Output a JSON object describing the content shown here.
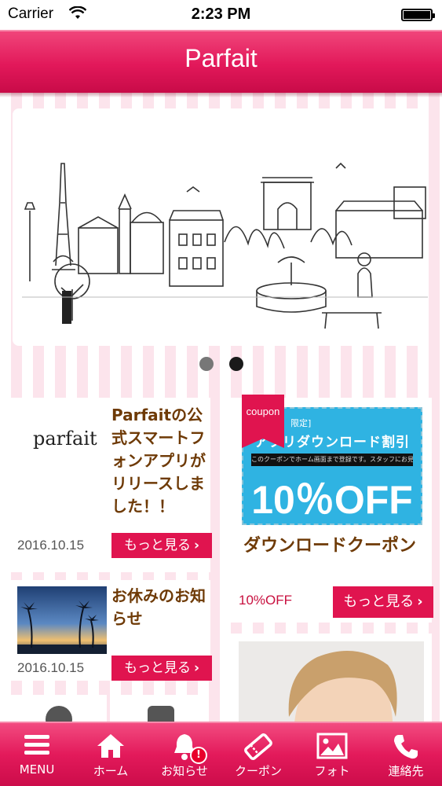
{
  "status_bar": {
    "carrier": "Carrier",
    "time": "2:23 PM"
  },
  "header": {
    "title": "Parfait"
  },
  "slider": {
    "page_count": 2,
    "active_index": 1
  },
  "news": [
    {
      "thumb_text": "parfait",
      "title": "Parfaitの公式スマートフォンアプリがリリースしました！！",
      "date": "2016.10.15",
      "more_label": "もっと見る"
    },
    {
      "title": "お休みのお知らせ",
      "date": "2016.10.15",
      "more_label": "もっと見る"
    }
  ],
  "coupon": {
    "ribbon": "coupon",
    "tag": "限定]",
    "banner_head": "アプリダウンロード割引",
    "banner_note": "このクーポンでホーム画面まで登録です。スタッフにお見せください",
    "banner_percent": "10％OFF",
    "title": "ダウンロードクーポン",
    "discount": "10%OFF",
    "more_label": "もっと見る"
  },
  "tabs": [
    {
      "label": "MENU",
      "icon": "menu-icon"
    },
    {
      "label": "ホーム",
      "icon": "home-icon"
    },
    {
      "label": "お知らせ",
      "icon": "bell-icon",
      "badge": "!"
    },
    {
      "label": "クーポン",
      "icon": "ticket-icon"
    },
    {
      "label": "フォト",
      "icon": "photo-icon"
    },
    {
      "label": "連絡先",
      "icon": "phone-icon"
    }
  ],
  "colors": {
    "brand": "#e0144f",
    "title_brown": "#6e3a06",
    "coupon_blue": "#2fb3e2"
  }
}
